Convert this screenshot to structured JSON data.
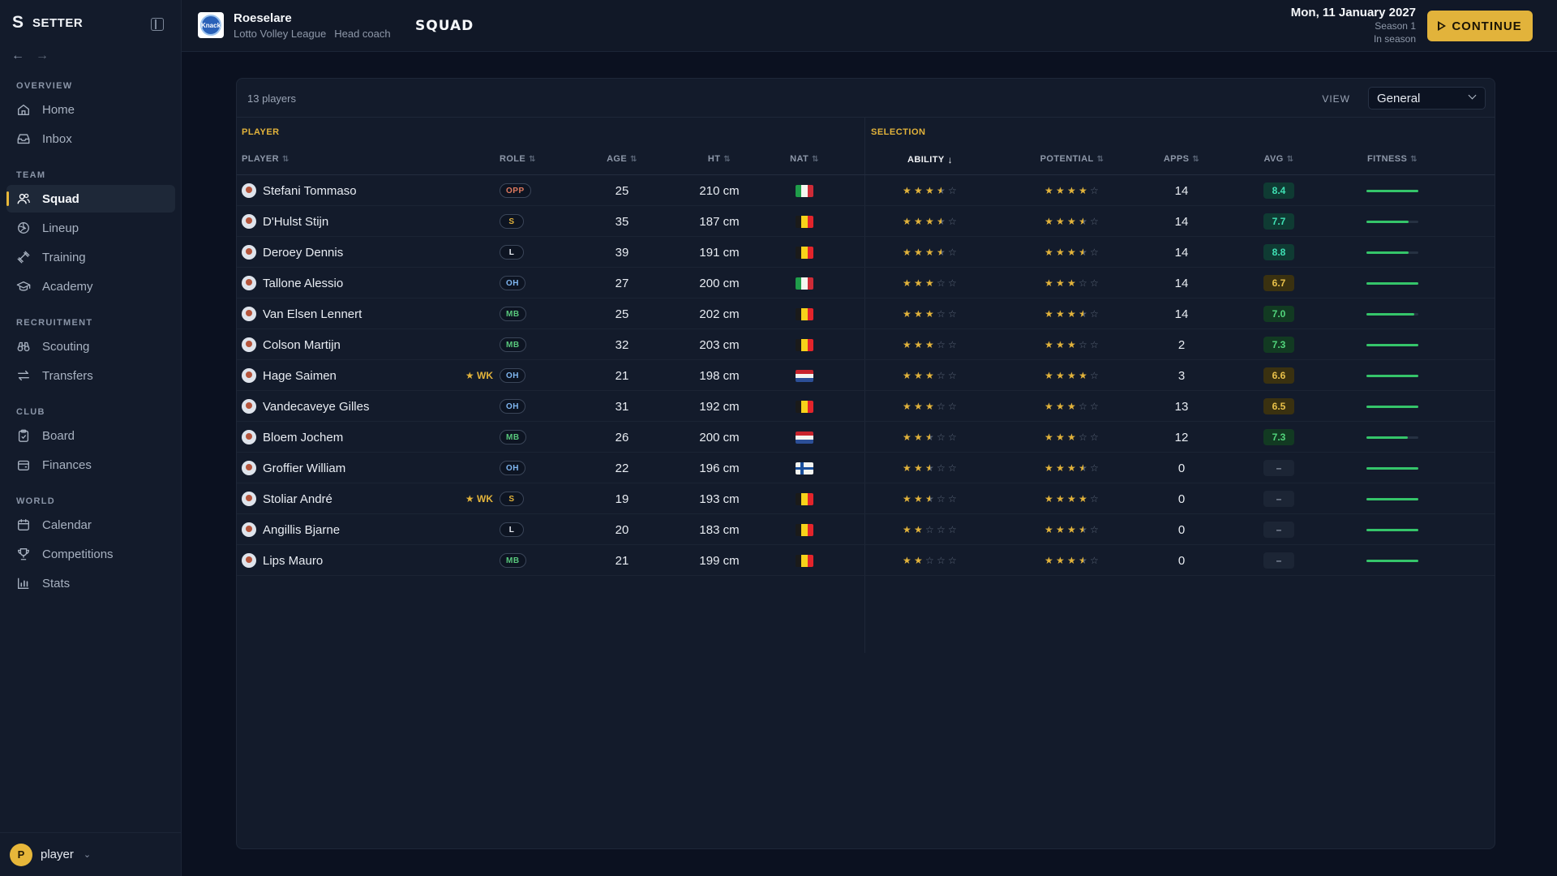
{
  "app": {
    "logo": "S",
    "name": "SETTER"
  },
  "nav": {
    "sections": [
      {
        "title": "OVERVIEW",
        "items": [
          {
            "label": "Home",
            "icon": "home-icon"
          },
          {
            "label": "Inbox",
            "icon": "inbox-icon"
          }
        ]
      },
      {
        "title": "TEAM",
        "items": [
          {
            "label": "Squad",
            "icon": "users-icon",
            "active": true
          },
          {
            "label": "Lineup",
            "icon": "volleyball-icon"
          },
          {
            "label": "Training",
            "icon": "dumbbell-icon"
          },
          {
            "label": "Academy",
            "icon": "graduation-cap-icon"
          }
        ]
      },
      {
        "title": "RECRUITMENT",
        "items": [
          {
            "label": "Scouting",
            "icon": "binoculars-icon"
          },
          {
            "label": "Transfers",
            "icon": "arrows-swap-icon"
          }
        ]
      },
      {
        "title": "CLUB",
        "items": [
          {
            "label": "Board",
            "icon": "clipboard-icon"
          },
          {
            "label": "Finances",
            "icon": "wallet-icon"
          }
        ]
      },
      {
        "title": "WORLD",
        "items": [
          {
            "label": "Calendar",
            "icon": "calendar-icon"
          },
          {
            "label": "Competitions",
            "icon": "trophy-icon"
          },
          {
            "label": "Stats",
            "icon": "bar-chart-icon"
          }
        ]
      }
    ]
  },
  "user": {
    "initial": "P",
    "name": "player"
  },
  "header": {
    "club_name": "Roeselare",
    "crest_text": "Knack",
    "league": "Lotto Volley League",
    "role": "Head coach",
    "page_title": "SQUAD",
    "date": "Mon, 11 January 2027",
    "season": "Season 1",
    "phase": "In season",
    "continue_label": "CONTINUE"
  },
  "squad": {
    "count_label": "13 players",
    "view_label": "VIEW",
    "view_value": "General",
    "group_player": "PLAYER",
    "group_selection": "SELECTION",
    "columns": {
      "player": "PLAYER",
      "role": "ROLE",
      "age": "AGE",
      "ht": "HT",
      "nat": "NAT",
      "ability": "ABILITY",
      "potential": "POTENTIAL",
      "apps": "APPS",
      "avg": "AVG",
      "fitness": "FITNESS"
    },
    "sort_icon": "⇅",
    "sort_active_icon": "↓",
    "wk_label": "★ WK",
    "rows": [
      {
        "name": "Stefani Tommaso",
        "wk": false,
        "role": "OPP",
        "age": "25",
        "height": "210 cm",
        "nat": "IT",
        "ability": 3.5,
        "potential": 4,
        "apps": "14",
        "avg": "8.4",
        "fitness": 1.0
      },
      {
        "name": "D'Hulst Stijn",
        "wk": false,
        "role": "S",
        "age": "35",
        "height": "187 cm",
        "nat": "BE",
        "ability": 3.5,
        "potential": 3.5,
        "apps": "14",
        "avg": "7.7",
        "fitness": 0.82
      },
      {
        "name": "Deroey Dennis",
        "wk": false,
        "role": "L",
        "age": "39",
        "height": "191 cm",
        "nat": "BE",
        "ability": 3.5,
        "potential": 3.5,
        "apps": "14",
        "avg": "8.8",
        "fitness": 0.82
      },
      {
        "name": "Tallone Alessio",
        "wk": false,
        "role": "OH",
        "age": "27",
        "height": "200 cm",
        "nat": "IT",
        "ability": 3,
        "potential": 3,
        "apps": "14",
        "avg": "6.7",
        "fitness": 1.0
      },
      {
        "name": "Van Elsen Lennert",
        "wk": false,
        "role": "MB",
        "age": "25",
        "height": "202 cm",
        "nat": "BE",
        "ability": 3,
        "potential": 3.5,
        "apps": "14",
        "avg": "7.0",
        "fitness": 0.92
      },
      {
        "name": "Colson Martijn",
        "wk": false,
        "role": "MB",
        "age": "32",
        "height": "203 cm",
        "nat": "BE",
        "ability": 3,
        "potential": 3,
        "apps": "2",
        "avg": "7.3",
        "fitness": 1.0
      },
      {
        "name": "Hage Saimen",
        "wk": true,
        "role": "OH",
        "age": "21",
        "height": "198 cm",
        "nat": "NL",
        "ability": 3,
        "potential": 4,
        "apps": "3",
        "avg": "6.6",
        "fitness": 1.0
      },
      {
        "name": "Vandecaveye Gilles",
        "wk": false,
        "role": "OH",
        "age": "31",
        "height": "192 cm",
        "nat": "BE",
        "ability": 3,
        "potential": 3,
        "apps": "13",
        "avg": "6.5",
        "fitness": 1.0
      },
      {
        "name": "Bloem Jochem",
        "wk": false,
        "role": "MB",
        "age": "26",
        "height": "200 cm",
        "nat": "NL",
        "ability": 2.5,
        "potential": 3,
        "apps": "12",
        "avg": "7.3",
        "fitness": 0.8
      },
      {
        "name": "Groffier William",
        "wk": false,
        "role": "OH",
        "age": "22",
        "height": "196 cm",
        "nat": "FI",
        "ability": 2.5,
        "potential": 3.5,
        "apps": "0",
        "avg": "–",
        "fitness": 1.0
      },
      {
        "name": "Stoliar André",
        "wk": true,
        "role": "S",
        "age": "19",
        "height": "193 cm",
        "nat": "BE",
        "ability": 2.5,
        "potential": 4,
        "apps": "0",
        "avg": "–",
        "fitness": 1.0
      },
      {
        "name": "Angillis Bjarne",
        "wk": false,
        "role": "L",
        "age": "20",
        "height": "183 cm",
        "nat": "BE",
        "ability": 2,
        "potential": 3.5,
        "apps": "0",
        "avg": "–",
        "fitness": 1.0
      },
      {
        "name": "Lips Mauro",
        "wk": false,
        "role": "MB",
        "age": "21",
        "height": "199 cm",
        "nat": "BE",
        "ability": 2,
        "potential": 3.5,
        "apps": "0",
        "avg": "–",
        "fitness": 1.0
      }
    ]
  },
  "colors": {
    "accent": "#e2b33b",
    "role_OPP": "#e07a5f",
    "role_S": "#e2b33b",
    "role_L": "#e8ecf2",
    "role_OH": "#7fb6f0",
    "role_MB": "#58c77c",
    "avg_high_bg": "#0f3b33",
    "avg_high_fg": "#3fe0b4",
    "avg_mid_bg": "#123a22",
    "avg_mid_fg": "#52d67c",
    "avg_low_bg": "#3a3110",
    "avg_low_fg": "#e9c14a",
    "avg_none_bg": "#1c2535",
    "avg_none_fg": "#8e98a9",
    "fitness": "#35c56a"
  }
}
